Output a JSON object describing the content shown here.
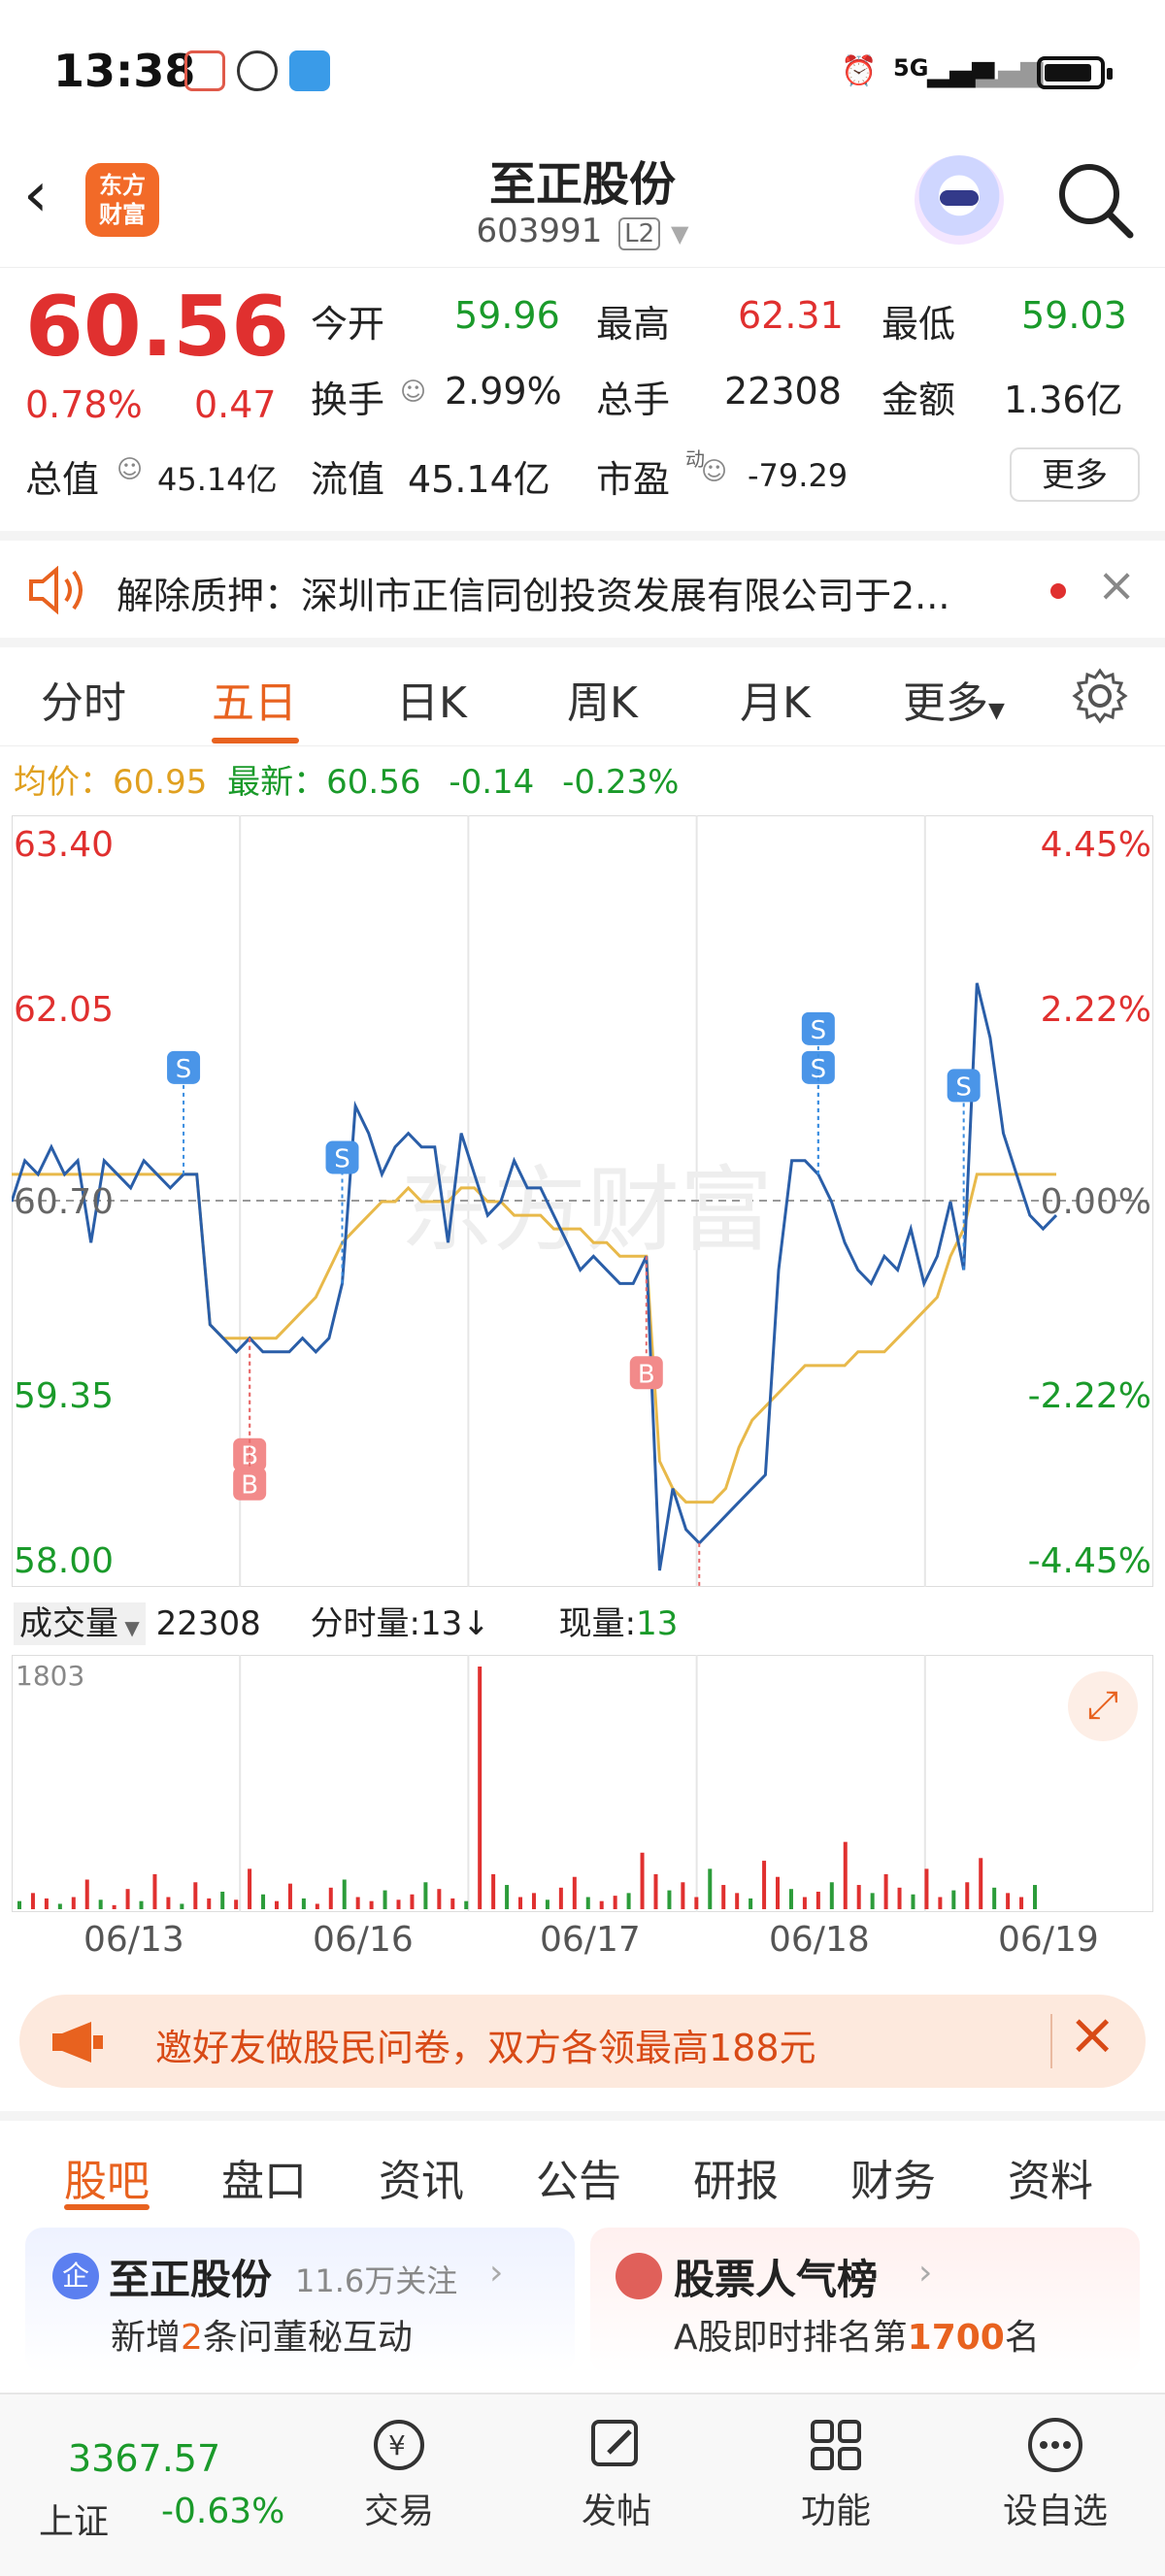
{
  "status_bar": {
    "time": "13:38",
    "network": "5G"
  },
  "header": {
    "title": "至正股份",
    "code": "603991",
    "level": "L2"
  },
  "quote": {
    "price": "60.56",
    "change_pct": "0.78%",
    "change": "0.47",
    "open_label": "今开",
    "open": "59.96",
    "high_label": "最高",
    "high": "62.31",
    "low_label": "最低",
    "low": "59.03",
    "turnover_label": "换手",
    "turnover": "2.99%",
    "volume_label": "总手",
    "volume": "22308",
    "amount_label": "金额",
    "amount": "1.36亿",
    "mktcap_label": "总值",
    "mktcap": "45.14亿",
    "float_label": "流值",
    "float": "45.14亿",
    "pe_label": "市盈",
    "pe_sup": "动",
    "pe": "-79.29",
    "more_label": "更多"
  },
  "news": {
    "text": "解除质押：深圳市正信同创投资发展有限公司于2..."
  },
  "period_tabs": [
    "分时",
    "五日",
    "日K",
    "周K",
    "月K",
    "更多"
  ],
  "avg_line": {
    "avg_label": "均价：",
    "avg_value": "60.95",
    "latest_label": "最新：",
    "latest_value": "60.56",
    "chg": "-0.14",
    "chg_pct": "-0.23%"
  },
  "chart_data": {
    "type": "line",
    "x": [
      "06/13",
      "06/16",
      "06/17",
      "06/18",
      "06/19"
    ],
    "y_left_ticks": [
      "63.40",
      "62.05",
      "60.70",
      "59.35",
      "58.00"
    ],
    "y_right_ticks": [
      "4.45%",
      "2.22%",
      "0.00%",
      "-2.22%",
      "-4.45%"
    ],
    "ylim": [
      58.0,
      63.4
    ],
    "baseline": 60.7,
    "watermark": "东方财富",
    "series": [
      {
        "name": "price",
        "values": [
          60.7,
          61.0,
          60.9,
          61.1,
          60.9,
          61.0,
          60.4,
          61.0,
          60.9,
          60.8,
          61.0,
          60.9,
          60.8,
          60.9,
          60.9,
          59.8,
          59.7,
          59.6,
          59.7,
          59.6,
          59.6,
          59.6,
          59.7,
          59.6,
          59.7,
          60.1,
          61.4,
          61.2,
          60.9,
          61.1,
          61.2,
          61.1,
          61.1,
          60.4,
          61.2,
          60.9,
          60.6,
          60.7,
          61.0,
          60.8,
          60.8,
          60.6,
          60.4,
          60.2,
          60.3,
          60.2,
          60.1,
          60.1,
          60.3,
          58.0,
          58.6,
          58.3,
          58.2,
          58.3,
          58.4,
          58.5,
          58.6,
          58.7,
          60.2,
          61.0,
          61.0,
          60.9,
          60.7,
          60.4,
          60.2,
          60.1,
          60.3,
          60.2,
          60.5,
          60.1,
          60.3,
          60.7,
          60.2,
          62.3,
          61.9,
          61.2,
          60.9,
          60.6,
          60.5,
          60.6
        ]
      },
      {
        "name": "avg",
        "values": [
          60.9,
          60.9,
          60.9,
          60.9,
          60.9,
          60.9,
          60.9,
          60.9,
          60.9,
          60.9,
          60.9,
          60.9,
          60.9,
          60.9,
          60.9,
          59.8,
          59.7,
          59.7,
          59.7,
          59.7,
          59.7,
          59.8,
          59.9,
          60.0,
          60.2,
          60.4,
          60.5,
          60.6,
          60.7,
          60.7,
          60.8,
          60.7,
          60.7,
          60.7,
          60.8,
          60.8,
          60.7,
          60.7,
          60.6,
          60.6,
          60.6,
          60.5,
          60.5,
          60.5,
          60.4,
          60.4,
          60.3,
          60.3,
          60.3,
          58.8,
          58.6,
          58.5,
          58.5,
          58.5,
          58.6,
          58.9,
          59.1,
          59.2,
          59.3,
          59.4,
          59.5,
          59.5,
          59.5,
          59.5,
          59.6,
          59.6,
          59.6,
          59.7,
          59.8,
          59.9,
          60.0,
          60.3,
          60.5,
          60.9,
          60.9,
          60.9,
          60.9,
          60.9,
          60.9,
          60.9
        ]
      }
    ],
    "markers": [
      "S",
      "S",
      "S",
      "S",
      "S",
      "B",
      "B",
      "B",
      "B"
    ]
  },
  "volume": {
    "label": "成交量",
    "total": "22308",
    "minute_label": "分时量:",
    "minute": "13↓",
    "now_label": "现量:",
    "now": "13",
    "max": "1803",
    "values": [
      60,
      120,
      80,
      40,
      90,
      220,
      70,
      30,
      150,
      60,
      260,
      90,
      40,
      200,
      80,
      130,
      70,
      300,
      110,
      60,
      190,
      80,
      40,
      160,
      220,
      90,
      60,
      140,
      70,
      110,
      200,
      150,
      80,
      60,
      1803,
      260,
      180,
      90,
      120,
      70,
      160,
      240,
      90,
      60,
      100,
      120,
      420,
      260,
      140,
      200,
      90,
      300,
      180,
      120,
      80,
      360,
      240,
      150,
      90,
      130,
      200,
      500,
      180,
      120,
      260,
      160,
      110,
      300,
      90,
      140,
      200,
      380,
      160,
      120,
      90,
      180
    ]
  },
  "banner": {
    "text": "邀好友做股民问卷，双方各领最高188元"
  },
  "info_tabs": [
    "股吧",
    "盘口",
    "资讯",
    "公告",
    "研报",
    "财务",
    "资料"
  ],
  "cards": [
    {
      "title": "至正股份",
      "sub": "11.6万关注",
      "line_pre": "新增",
      "line_num": "2",
      "line_post": "条问董秘互动"
    },
    {
      "title": "股票人气榜",
      "line_pre": "A股即时排名第",
      "line_num": "1700",
      "line_post": "名"
    }
  ],
  "footer": {
    "index_value": "3367.57",
    "index_label": "上证",
    "index_chg": "-0.63%",
    "items": [
      "交易",
      "发帖",
      "功能",
      "设自选"
    ]
  }
}
